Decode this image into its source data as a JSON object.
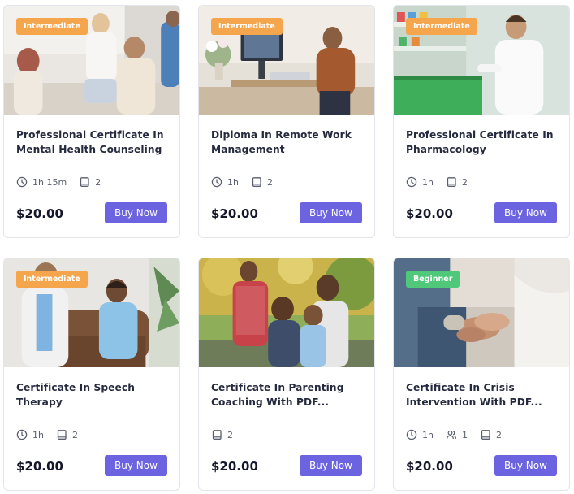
{
  "colors": {
    "badge_intermediate": "#f5a54b",
    "badge_beginner": "#4fc87a",
    "button": "#6c63e0",
    "card_border": "#e3e5ec"
  },
  "courses": [
    {
      "level": "Intermediate",
      "title": "Professional Certificate In Mental Health Counseling",
      "duration": "1h 15m",
      "lessons": "2",
      "price": "$20.00",
      "button": "Buy Now",
      "image": "group-counseling-photo"
    },
    {
      "level": "Intermediate",
      "title": "Diploma In Remote Work Management",
      "duration": "1h",
      "lessons": "2",
      "price": "$20.00",
      "button": "Buy Now",
      "image": "man-at-computer-photo"
    },
    {
      "level": "Intermediate",
      "title": "Professional Certificate In Pharmacology",
      "duration": "1h",
      "lessons": "2",
      "price": "$20.00",
      "button": "Buy Now",
      "image": "pharmacist-photo"
    },
    {
      "level": "Intermediate",
      "title": "Certificate In Speech Therapy",
      "duration": "1h",
      "lessons": "2",
      "price": "$20.00",
      "button": "Buy Now",
      "image": "speech-therapy-photo"
    },
    {
      "title": "Certificate In Parenting Coaching With PDF...",
      "lessons": "2",
      "price": "$20.00",
      "button": "Buy Now",
      "image": "family-outdoors-photo"
    },
    {
      "level": "Beginner",
      "title": "Certificate In Crisis Intervention With PDF...",
      "duration": "1h",
      "students": "1",
      "lessons": "2",
      "price": "$20.00",
      "button": "Buy Now",
      "image": "holding-hands-photo"
    }
  ]
}
